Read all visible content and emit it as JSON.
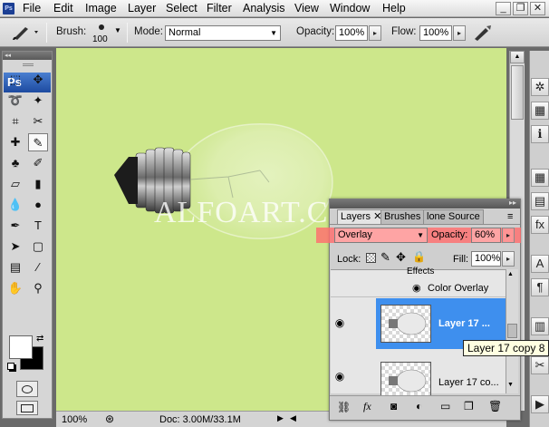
{
  "menu": {
    "app_icon": "Ps",
    "items": [
      "File",
      "Edit",
      "Image",
      "Layer",
      "Select",
      "Filter",
      "Analysis",
      "View",
      "Window",
      "Help"
    ],
    "window_buttons": [
      "_",
      "❐",
      "✕"
    ]
  },
  "options": {
    "brush_label": "Brush:",
    "brush_size": "100",
    "mode_label": "Mode:",
    "mode_value": "Normal",
    "opacity_label": "Opacity:",
    "opacity_value": "100%",
    "flow_label": "Flow:",
    "flow_value": "100%"
  },
  "toolbox": {
    "header": "◂◂",
    "logo": "Ps",
    "tools": [
      [
        "marquee-tool",
        "⬚"
      ],
      [
        "move-tool",
        "✥"
      ],
      [
        "lasso-tool",
        "➰"
      ],
      [
        "magic-wand-tool",
        "✦"
      ],
      [
        "crop-tool",
        "⌗"
      ],
      [
        "slice-tool",
        "✂"
      ],
      [
        "healing-tool",
        "✚"
      ],
      [
        "brush-tool",
        "✎"
      ],
      [
        "stamp-tool",
        "♣"
      ],
      [
        "history-brush-tool",
        "✐"
      ],
      [
        "eraser-tool",
        "▱"
      ],
      [
        "gradient-tool",
        "▮"
      ],
      [
        "blur-tool",
        "💧"
      ],
      [
        "dodge-tool",
        "●"
      ],
      [
        "pen-tool",
        "✒"
      ],
      [
        "type-tool",
        "T"
      ],
      [
        "path-selection-tool",
        "➤"
      ],
      [
        "shape-tool",
        "▢"
      ],
      [
        "notes-tool",
        "▤"
      ],
      [
        "eyedropper-tool",
        "⁄"
      ],
      [
        "hand-tool",
        "✋"
      ],
      [
        "zoom-tool",
        "⚲"
      ]
    ]
  },
  "canvas": {
    "background": "#cde78b",
    "watermark": "ALFOART.COM"
  },
  "status": {
    "zoom": "100%",
    "doc": "Doc: 3.00M/33.1M"
  },
  "layers_panel": {
    "tabs": [
      "Layers ✕",
      "Brushes",
      "lone Source"
    ],
    "blend_mode": "Overlay",
    "opacity_label": "Opacity:",
    "opacity_value": "60%",
    "lock_label": "Lock:",
    "fill_label": "Fill:",
    "fill_value": "100%",
    "effects_label": "Effects",
    "color_overlay_label": "Color Overlay",
    "layers": [
      {
        "name": "Layer 17 ...",
        "selected": true
      },
      {
        "name": "Layer 17 co...",
        "selected": false
      }
    ],
    "selected_color": "#3e8fee",
    "tooltip": "Layer 17 copy 8",
    "bottom_icons": [
      "link-icon",
      "fx-icon",
      "mask-icon",
      "adjustment-icon",
      "folder-icon",
      "new-layer-icon",
      "trash-icon"
    ]
  },
  "dock": [
    "navigator-icon",
    "histogram-icon",
    "info-icon",
    "swatches-icon",
    "styles-icon",
    "fx-icon",
    "character-icon",
    "paragraph-icon",
    "notes-icon",
    "tools-icon",
    "actions-icon"
  ]
}
